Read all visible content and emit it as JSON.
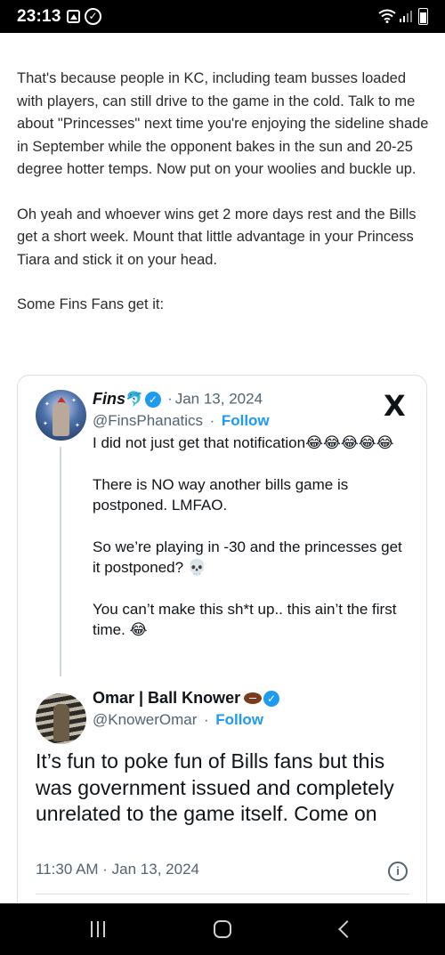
{
  "status_bar": {
    "time": "23:13",
    "icons": [
      "gallery-icon",
      "check-circle-icon",
      "wifi-icon",
      "signal-icon",
      "battery-icon"
    ]
  },
  "post": {
    "paragraph1": "That's because people in KC, including team busses loaded with players, can still drive to the game in the cold.  Talk to me about \"Princesses\" next time you're enjoying the sideline shade in September while the opponent bakes in the sun and 20-25 degree hotter temps.  Now put on your woolies and buckle up.",
    "paragraph2": "Oh yeah and whoever wins get 2 more days rest and the Bills get a short week.  Mount that little advantage in your Princess Tiara and stick it on your head.",
    "paragraph3": "Some Fins Fans get it:"
  },
  "embed": {
    "tweet1": {
      "display_name": "Fins",
      "name_emoji": "🐬",
      "dot": "·",
      "date": "Jan 13, 2024",
      "handle": "@FinsPhanatics",
      "follow_label": "Follow",
      "line1": "I did not just get that notification",
      "line1_emojis": "😂😂😂😂😂",
      "line2": "There is NO way another bills game is postponed. LMFAO.",
      "line3": "So we’re playing in -30 and the princesses get it postponed?",
      "line3_emoji": "💀",
      "line4": "You can’t make this sh*t up.. this ain’t the first time.",
      "line4_emoji": "😂"
    },
    "tweet2": {
      "display_name": "Omar | Ball Knower",
      "handle": "@KnowerOmar",
      "follow_label": "Follow",
      "text": "It’s fun to poke fun of Bills fans but this was government issued and completely unrelated to the game itself. Come on",
      "timestamp": "11:30 AM · Jan 13, 2024"
    },
    "x_logo": "X",
    "accent_color": "#1d9bf0"
  },
  "nav_bar": {
    "icons": [
      "recents-icon",
      "home-icon",
      "back-icon"
    ]
  }
}
